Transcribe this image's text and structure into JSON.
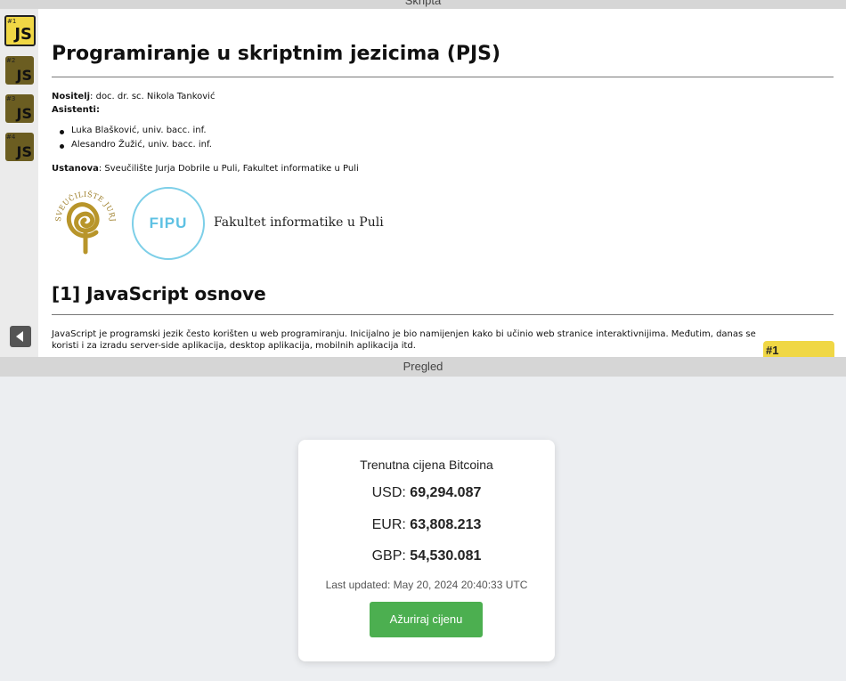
{
  "panels": {
    "top_header": "Skripta",
    "bottom_header": "Pregled"
  },
  "sidebar": {
    "tiles": [
      {
        "num": "#1",
        "label": "JS",
        "active": true
      },
      {
        "num": "#2",
        "label": "JS",
        "active": false
      },
      {
        "num": "#3",
        "label": "JS",
        "active": false
      },
      {
        "num": "#4",
        "label": "JS",
        "active": false
      }
    ]
  },
  "doc": {
    "title": "Programiranje u skriptnim jezicima (PJS)",
    "nositelj_label": "Nositelj",
    "nositelj_value": ": doc. dr. sc. Nikola Tanković",
    "asistenti_label": "Asistenti",
    "asistenti_suffix": ":",
    "assistants": [
      "Luka Blašković, univ. bacc. inf.",
      "Alesandro Žužić, univ. bacc. inf."
    ],
    "ustanova_label": "Ustanova",
    "ustanova_value": ": Sveučilište Jurja Dobrile u Puli, Fakultet informatike u Puli",
    "fipu_logo_text": "FIPU",
    "fipu_name": "Fakultet informatike u Puli",
    "unipu_logo_text": "SVEUČILIŠTE JURJA DOBRILE U PULI",
    "section_title": "[1] JavaScript osnove",
    "intro": "JavaScript je programski jezik često korišten u web programiranju. Inicijalno je bio namijenjen kako bi učinio web stranice interaktivnijima. Međutim, danas se koristi i za izradu server-side aplikacija, desktop aplikacija, mobilnih aplikacija itd.",
    "badge": "#1"
  },
  "card": {
    "title": "Trenutna cijena Bitcoina",
    "prices": [
      {
        "currency": "USD:",
        "value": "69,294.087"
      },
      {
        "currency": "EUR:",
        "value": "63,808.213"
      },
      {
        "currency": "GBP:",
        "value": "54,530.081"
      }
    ],
    "updated": "Last updated: May 20, 2024 20:40:33 UTC",
    "button": "Ažuriraj cijenu"
  },
  "colors": {
    "accent_green": "#4caf50",
    "js_yellow": "#f0d745",
    "fipu_blue": "#5ec1e3",
    "unipu_gold": "#b8952a"
  }
}
